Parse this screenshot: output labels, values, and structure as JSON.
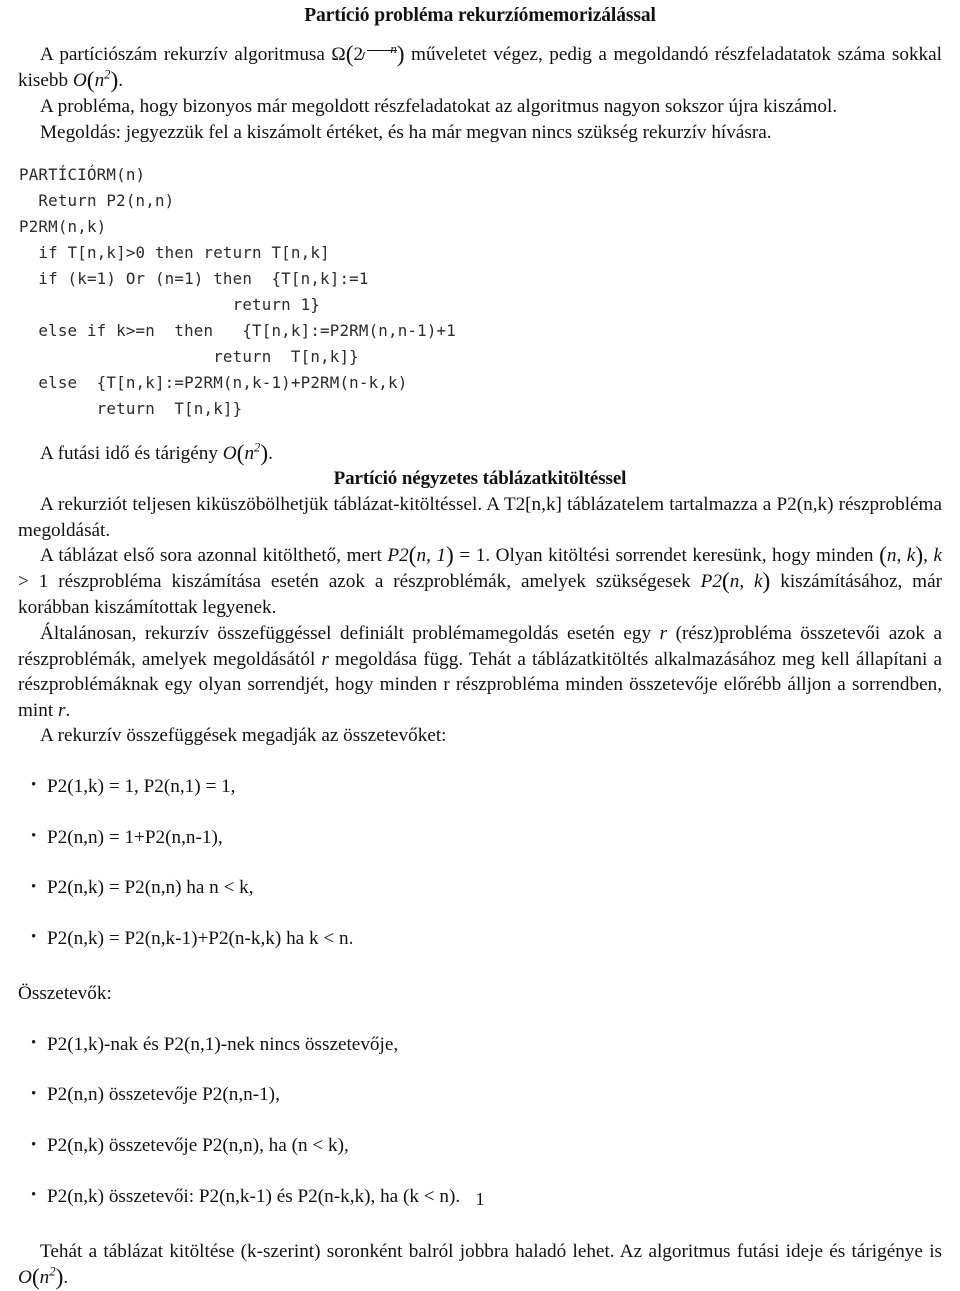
{
  "document": {
    "title": "Partíció probléma rekurzriómemorizálással",
    "title_display": "Partíció probléma rekurzíómemorizálással",
    "page_number": "1"
  },
  "intro": {
    "p1_a": "A partíciószám rekurzív algoritmusa ",
    "p1_omega": "Ω",
    "p1_base": "2",
    "p1_sqrt_arg": "n",
    "p1_b": " műveletet végez, pedig a megoldandó részfeladatatok száma sokkal kisebb ",
    "p1_big_o": "O",
    "p1_o_arg": "n",
    "p1_o_exp": "2",
    "p1_c": ".",
    "p2": "A probléma, hogy bizonyos már megoldott részfeladatokat az algoritmus nagyon sokszor újra kiszámol.",
    "p3": "Megoldás: jegyezzük fel a kiszámolt értéket, és ha már megvan nincs szükség rekurzív hívásra."
  },
  "code": {
    "lines": [
      "PARTÍCIÓRM(n)",
      "  Return P2(n,n)",
      "P2RM(n,k)",
      "  if T[n,k]>0 then return T[n,k]",
      "  if (k=1) Or (n=1) then  {T[n,k]:=1",
      "                      return 1}",
      "  else if k>=n  then   {T[n,k]:=P2RM(n,n-1)+1",
      "                    return  T[n,k]}",
      "  else  {T[n,k]:=P2RM(n,k-1)+P2RM(n-k,k)",
      "        return  T[n,k]}"
    ],
    "text": "PARTÍCIÓRM(n)\n  Return P2(n,n)\nP2RM(n,k)\n  if T[n,k]>0 then return T[n,k]\n  if (k=1) Or (n=1) then  {T[n,k]:=1\n                      return 1}\n  else if k>=n  then   {T[n,k]:=P2RM(n,n-1)+1\n                    return  T[n,k]}\n  else  {T[n,k]:=P2RM(n,k-1)+P2RM(n-k,k)\n        return  T[n,k]}"
  },
  "runtime_note": {
    "a": "A futási idő és tárigény ",
    "big_o": "O",
    "o_arg": "n",
    "o_exp": "2",
    "b": "."
  },
  "section2": {
    "heading": "Partíció négyzetes táblázatkitöltéssel",
    "p1": "A rekurziót teljesen kiküszöbölhetjük táblázat-kitöltéssel. A T2[n,k] táblázatelem tartalmazza a P2(n,k) részprobléma megoldását.",
    "p2_a": "A táblázat első sora azonnal kitölthető, mert ",
    "p2_f1": "P2",
    "p2_f1_args": "n, 1",
    "p2_f1_tail": " = 1",
    "p2_b": ". Olyan kitöltési sorrendet keresünk, hogy minden ",
    "p2_f2_args": "n, k",
    "p2_c": ", ",
    "p2_k": "k",
    "p2_d": " > 1 részprobléma kiszámítása esetén azok a részproblémák, amelyek szükségesek ",
    "p2_f3": "P2",
    "p2_f3_args": "n, k",
    "p2_e": " kiszámításához, már korábban kiszámítottak legyenek.",
    "p3_a": "Általánosan, rekurzív összefüggéssel definiált problémamegoldás esetén egy ",
    "p3_r1": "r",
    "p3_b": " (rész)probléma összetevői azok a részproblémák, amelyek megoldásától ",
    "p3_r2": "r",
    "p3_c": " megoldása függ. Tehát a táblázatkitöltés alkalmazásához meg kell állapítani a részproblémáknak egy olyan sorrendjét, hogy minden r részprobléma minden összetevője előrébb álljon a sorrendben, mint ",
    "p3_r3": "r",
    "p3_d": ".",
    "p4": "A rekurzív összefüggések megadják az összetevőket:"
  },
  "recurrences": [
    "P2(1,k) = 1, P2(n,1) = 1,",
    "P2(n,n) = 1+P2(n,n-1),",
    "P2(n,k) = P2(n,n) ha n < k,",
    "P2(n,k) = P2(n,k-1)+P2(n-k,k) ha k < n."
  ],
  "components": {
    "label": "Összetevők:",
    "items": [
      "P2(1,k)-nak és P2(n,1)-nek nincs összetevője,",
      "P2(n,n) összetevője P2(n,n-1),",
      "P2(n,k) összetevője P2(n,n), ha (n < k),",
      "P2(n,k) összetevői: P2(n,k-1) és P2(n-k,k), ha (k < n)."
    ]
  },
  "conclusion": {
    "a": "Tehát a táblázat kitöltése (k-szerint) soronként balról jobbra haladó lehet.  Az algoritmus futási ideje és tárigénye is ",
    "big_o": "O",
    "o_arg": "n",
    "o_exp": "2",
    "b": "."
  }
}
